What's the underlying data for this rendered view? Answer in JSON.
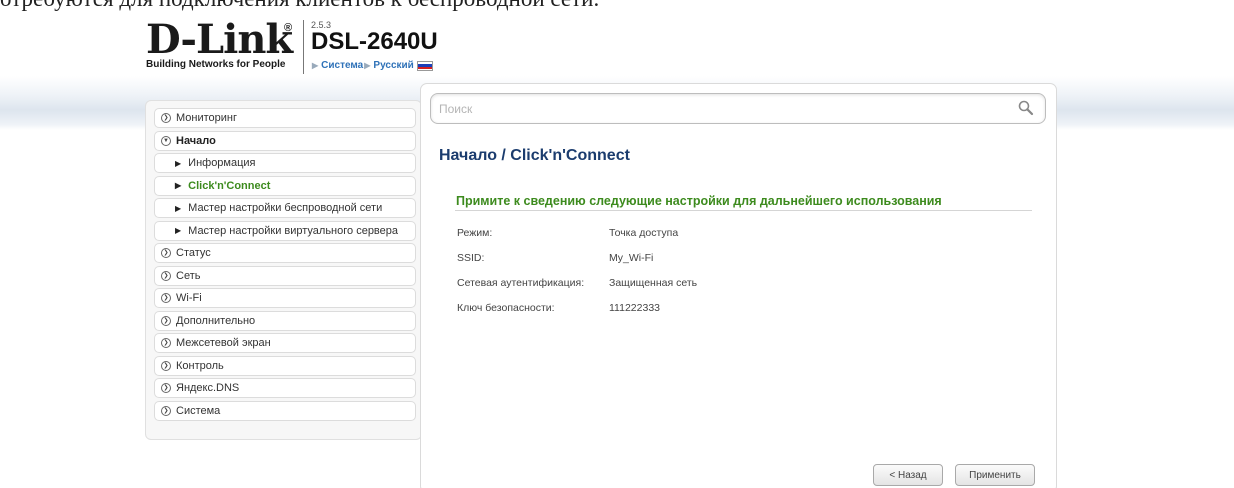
{
  "top_cut_text": "отребуются для подключения клиентов к беспроводной сети.",
  "logo": {
    "brand": "D-Link",
    "registered": "®",
    "tagline": "Building Networks for People"
  },
  "device": {
    "firmware_version": "2.5.3",
    "model": "DSL-2640U",
    "links": [
      "Система",
      "Русский"
    ]
  },
  "search": {
    "placeholder": "Поиск"
  },
  "sidebar": {
    "items": [
      {
        "label": "Мониторинг"
      },
      {
        "label": "Начало"
      },
      {
        "label": "Информация"
      },
      {
        "label": "Click'n'Connect"
      },
      {
        "label": "Мастер настройки беспроводной сети"
      },
      {
        "label": "Мастер настройки виртуального сервера"
      },
      {
        "label": "Статус"
      },
      {
        "label": "Сеть"
      },
      {
        "label": "Wi-Fi"
      },
      {
        "label": "Дополнительно"
      },
      {
        "label": "Межсетевой экран"
      },
      {
        "label": "Контроль"
      },
      {
        "label": "Яндекс.DNS"
      },
      {
        "label": "Система"
      }
    ]
  },
  "main": {
    "breadcrumb": "Начало /  Click'n'Connect",
    "section_title": "Примите к сведению следующие настройки для дальнейшего использования",
    "settings": [
      {
        "label": "Режим:",
        "value": "Точка доступа"
      },
      {
        "label": "SSID:",
        "value": "My_Wi-Fi"
      },
      {
        "label": "Сетевая аутентификация:",
        "value": "Защищенная сеть"
      },
      {
        "label": "Ключ безопасности:",
        "value": "111222333"
      }
    ],
    "buttons": {
      "back": "< Назад",
      "apply": "Применить"
    }
  },
  "colors": {
    "accent_green": "#3d8b1e",
    "title_blue": "#1b3c6e",
    "link_blue": "#2f72b8"
  },
  "icons": {
    "search": "search-icon",
    "collapsed": "chevron-circle-icon",
    "expanded": "chevron-circle-down-icon",
    "subitem": "triangle-right-icon"
  }
}
